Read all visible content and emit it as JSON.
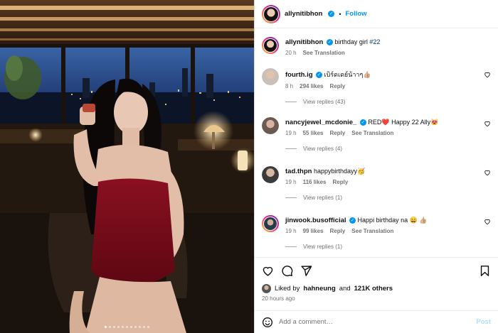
{
  "post": {
    "author": "allynitibhon",
    "follow_label": "Follow",
    "separator": "•",
    "caption": {
      "username": "allynitibhon",
      "text": "birthday girl",
      "hashtag": "#22",
      "time": "20 h",
      "see_translation": "See Translation"
    },
    "carousel": {
      "count": 11,
      "active_index": 0
    }
  },
  "comments": [
    {
      "username": "fourth.ig",
      "verified": true,
      "text": "เบิร์ดเดย์น้าาๆ👍🏼",
      "time": "8 h",
      "likes": "294 likes",
      "reply": "Reply",
      "see_translation": "",
      "view_replies": "View replies (43)",
      "avatar_color": "#c9c0b8"
    },
    {
      "username": "nancyjewel_mcdonie_",
      "verified": true,
      "text": "RED❤️ Happy 22 Ally😻",
      "time": "19 h",
      "likes": "55 likes",
      "reply": "Reply",
      "see_translation": "See Translation",
      "view_replies": "View replies (4)",
      "avatar_color": "#6b5a52"
    },
    {
      "username": "tad.thpn",
      "verified": false,
      "text": "happybirthdayy🥳",
      "time": "19 h",
      "likes": "116 likes",
      "reply": "Reply",
      "see_translation": "",
      "view_replies": "View replies (1)",
      "avatar_color": "#3c3c3c"
    },
    {
      "username": "jinwook.busofficial",
      "verified": true,
      "text": "Happi birthday na 😄 👍🏼",
      "time": "19 h",
      "likes": "99 likes",
      "reply": "Reply",
      "see_translation": "See Translation",
      "view_replies": "View replies (1)",
      "avatar_color": "#2a3a48"
    }
  ],
  "liked_by": {
    "prefix": "Liked by",
    "user": "hahneung",
    "and": "and",
    "others": "121K others"
  },
  "posted_ago": "20 hours ago",
  "add_comment": {
    "placeholder": "Add a comment…",
    "post_label": "Post"
  },
  "colors": {
    "accent": "#0095f6",
    "muted": "#737373",
    "post_disabled": "#b2dffc"
  }
}
